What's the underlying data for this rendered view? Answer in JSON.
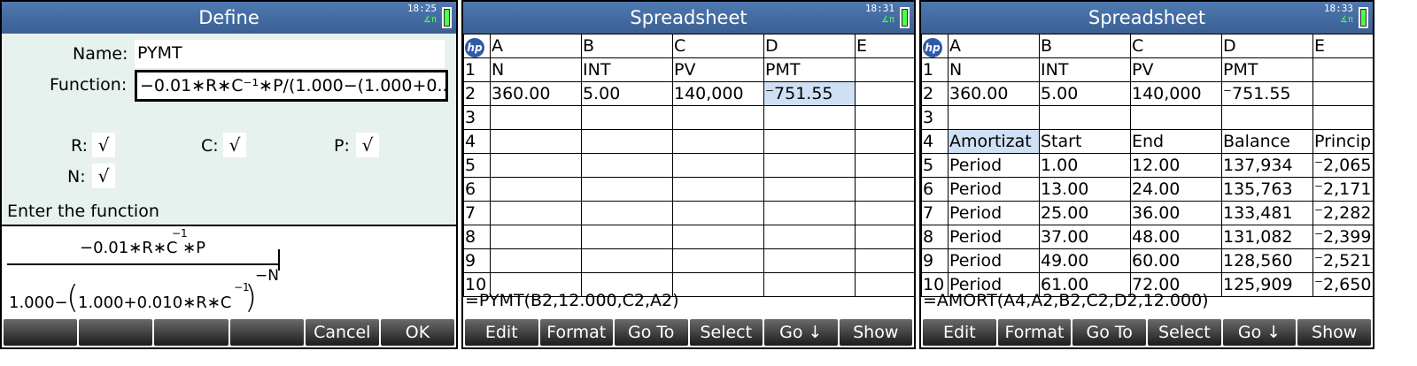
{
  "screens": {
    "define": {
      "title": "Define",
      "clock": "18:25",
      "angle_mode": "∡π",
      "name_label": "Name:",
      "name_value": "PYMT",
      "function_label": "Function:",
      "function_value": "−0.01∗R∗C⁻¹∗P/(1.000−(1.000+0....",
      "vars": [
        {
          "label": "R:",
          "checked": "√"
        },
        {
          "label": "C:",
          "checked": "√"
        },
        {
          "label": "P:",
          "checked": "√"
        },
        {
          "label": "N:",
          "checked": "√"
        }
      ],
      "help_text": "Enter the function",
      "preview": {
        "numerator": "−0.01∗R∗C",
        "num_exp": "−1",
        "num_tail": "∗P",
        "denominator": "1.000−",
        "inner": "1.000+0.010∗R∗C",
        "inner_exp": "−1",
        "outer_exp": "−N"
      },
      "softkeys": [
        "",
        "",
        "",
        "",
        "Cancel",
        "OK"
      ]
    },
    "spreadsheet1": {
      "title": "Spreadsheet",
      "clock": "18:31",
      "angle_mode": "∡π",
      "logo": "hp",
      "columns": [
        "A",
        "B",
        "C",
        "D",
        "E"
      ],
      "rows": [
        {
          "num": "1",
          "cells": [
            "N",
            "INT",
            "PV",
            "PMT",
            ""
          ]
        },
        {
          "num": "2",
          "cells": [
            "360.00",
            "5.00",
            "140,000",
            "⁻751.55",
            ""
          ]
        },
        {
          "num": "3",
          "cells": [
            "",
            "",
            "",
            "",
            ""
          ]
        },
        {
          "num": "4",
          "cells": [
            "",
            "",
            "",
            "",
            ""
          ]
        },
        {
          "num": "5",
          "cells": [
            "",
            "",
            "",
            "",
            ""
          ]
        },
        {
          "num": "6",
          "cells": [
            "",
            "",
            "",
            "",
            ""
          ]
        },
        {
          "num": "7",
          "cells": [
            "",
            "",
            "",
            "",
            ""
          ]
        },
        {
          "num": "8",
          "cells": [
            "",
            "",
            "",
            "",
            ""
          ]
        },
        {
          "num": "9",
          "cells": [
            "",
            "",
            "",
            "",
            ""
          ]
        },
        {
          "num": "10",
          "cells": [
            "",
            "",
            "",
            "",
            ""
          ]
        }
      ],
      "selected_cell": "D2",
      "edit_line": "=PYMT(B2,12.000,C2,A2)",
      "softkeys": [
        "Edit",
        "Format",
        "Go To",
        "Select",
        "Go ↓",
        "Show"
      ]
    },
    "spreadsheet2": {
      "title": "Spreadsheet",
      "clock": "18:33",
      "angle_mode": "∡π",
      "logo": "hp",
      "columns": [
        "A",
        "B",
        "C",
        "D",
        "E"
      ],
      "rows": [
        {
          "num": "1",
          "cells": [
            "N",
            "INT",
            "PV",
            "PMT",
            ""
          ]
        },
        {
          "num": "2",
          "cells": [
            "360.00",
            "5.00",
            "140,000",
            "⁻751.55",
            ""
          ]
        },
        {
          "num": "3",
          "cells": [
            "",
            "",
            "",
            "",
            ""
          ]
        },
        {
          "num": "4",
          "cells": [
            "Amortizat",
            "Start",
            "End",
            "Balance",
            "Princip"
          ]
        },
        {
          "num": "5",
          "cells": [
            "Period",
            "1.00",
            "12.00",
            "137,934",
            "⁻2,065."
          ]
        },
        {
          "num": "6",
          "cells": [
            "Period",
            "13.00",
            "24.00",
            "135,763",
            "⁻2,171."
          ]
        },
        {
          "num": "7",
          "cells": [
            "Period",
            "25.00",
            "36.00",
            "133,481",
            "⁻2,282."
          ]
        },
        {
          "num": "8",
          "cells": [
            "Period",
            "37.00",
            "48.00",
            "131,082",
            "⁻2,399."
          ]
        },
        {
          "num": "9",
          "cells": [
            "Period",
            "49.00",
            "60.00",
            "128,560",
            "⁻2,521."
          ]
        },
        {
          "num": "10",
          "cells": [
            "Period",
            "61.00",
            "72.00",
            "125,909",
            "⁻2,650."
          ]
        }
      ],
      "selected_cell": "A4",
      "edit_line": "=AMORT(A4,A2,B2,C2,D2,12.000)",
      "softkeys": [
        "Edit",
        "Format",
        "Go To",
        "Select",
        "Go ↓",
        "Show"
      ]
    }
  }
}
